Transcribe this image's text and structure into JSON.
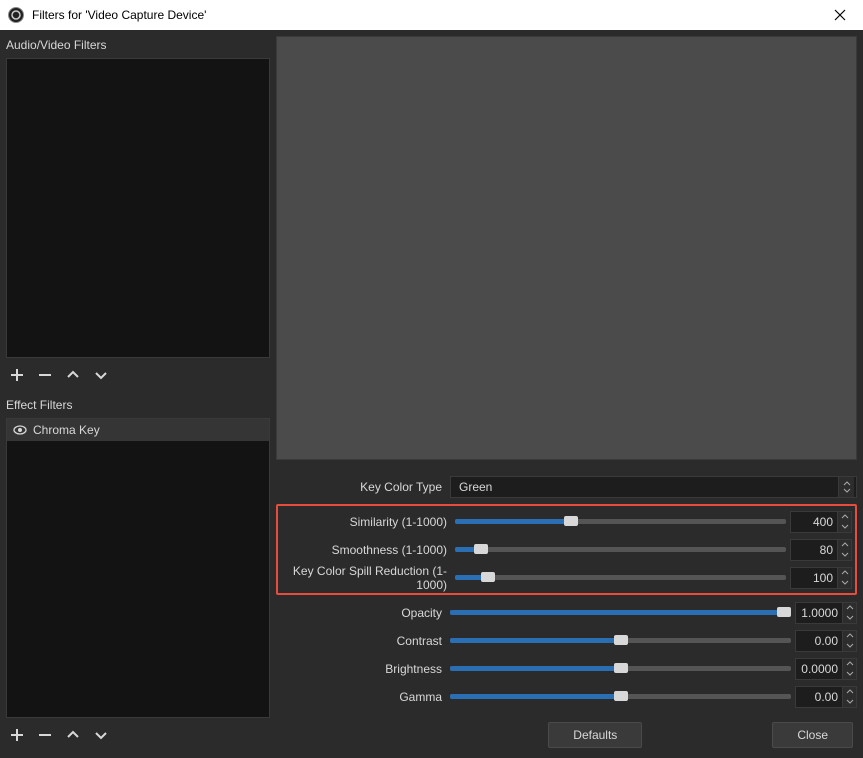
{
  "window": {
    "title": "Filters for 'Video Capture Device'"
  },
  "sections": {
    "audio_video": "Audio/Video Filters",
    "effect": "Effect Filters"
  },
  "effect_filters": [
    {
      "name": "Chroma Key"
    }
  ],
  "settings": {
    "key_color_type": {
      "label": "Key Color Type",
      "value": "Green"
    },
    "similarity": {
      "label": "Similarity (1-1000)",
      "value": "400",
      "min": 1,
      "max": 1000,
      "fill_pct": 35
    },
    "smoothness": {
      "label": "Smoothness (1-1000)",
      "value": "80",
      "min": 1,
      "max": 1000,
      "fill_pct": 8
    },
    "spill": {
      "label": "Key Color Spill Reduction (1-1000)",
      "value": "100",
      "min": 1,
      "max": 1000,
      "fill_pct": 10
    },
    "opacity": {
      "label": "Opacity",
      "value": "1.0000",
      "fill_pct": 100
    },
    "contrast": {
      "label": "Contrast",
      "value": "0.00",
      "fill_pct": 50
    },
    "brightness": {
      "label": "Brightness",
      "value": "0.0000",
      "fill_pct": 50
    },
    "gamma": {
      "label": "Gamma",
      "value": "0.00",
      "fill_pct": 50
    }
  },
  "buttons": {
    "defaults": "Defaults",
    "close": "Close"
  }
}
